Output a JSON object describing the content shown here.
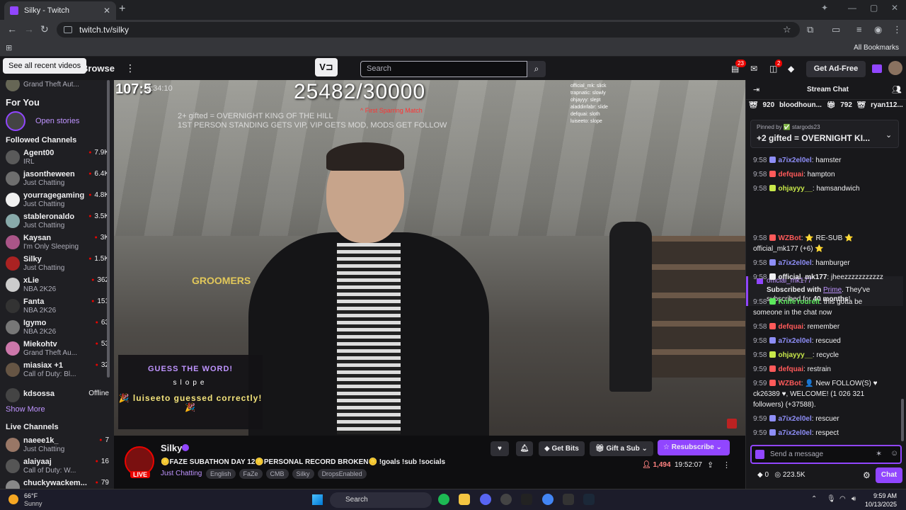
{
  "browser": {
    "tab_title": "Silky - Twitch",
    "url": "twitch.tv/silky",
    "all_bookmarks": "All Bookmarks"
  },
  "topnav": {
    "tooltip": "See all recent videos",
    "browse": "Browse",
    "search_placeholder": "Search",
    "notif_count": "23",
    "whisper_count": "2",
    "get_ad_free": "Get Ad-Free"
  },
  "sidebar": {
    "top_game": "Grand Theft Aut...",
    "for_you": "For You",
    "open_stories": "Open stories",
    "followed_header": "Followed Channels",
    "followed": [
      {
        "name": "Agent00",
        "game": "IRL",
        "viewers": "7.9K",
        "color": "#5a5a5a"
      },
      {
        "name": "jasontheween",
        "game": "Just Chatting",
        "viewers": "6.4K",
        "color": "#6e6e6e"
      },
      {
        "name": "yourragegaming",
        "game": "Just Chatting",
        "viewers": "4.8K",
        "color": "#f0f0f0"
      },
      {
        "name": "stableronaldo",
        "game": "Just Chatting",
        "viewers": "3.5K",
        "color": "#8aa"
      },
      {
        "name": "Kaysan",
        "game": "I'm Only Sleeping",
        "viewers": "3K",
        "color": "#a58"
      },
      {
        "name": "Silky",
        "game": "Just Chatting",
        "viewers": "1.5K",
        "color": "#a22"
      },
      {
        "name": "xLie",
        "game": "NBA 2K26",
        "viewers": "362",
        "color": "#ccc"
      },
      {
        "name": "Fanta",
        "game": "NBA 2K26",
        "viewers": "151",
        "color": "#333"
      },
      {
        "name": "Igymo",
        "game": "NBA 2K26",
        "viewers": "63",
        "color": "#777"
      },
      {
        "name": "Miekohtv",
        "game": "Grand Theft Au...",
        "viewers": "53",
        "color": "#c7a"
      },
      {
        "name": "miasiax +1",
        "game": "Call of Duty: Bl...",
        "viewers": "32",
        "color": "#654"
      }
    ],
    "offline": {
      "name": "kdsossa",
      "status": "Offline"
    },
    "show_more": "Show More",
    "live_header": "Live Channels",
    "live": [
      {
        "name": "naeee1k_",
        "game": "Just Chatting",
        "viewers": "7",
        "color": "#976"
      },
      {
        "name": "alaiyaaj",
        "game": "Call of Duty: W...",
        "viewers": "16",
        "color": "#555"
      },
      {
        "name": "chuckywackem...",
        "game": "",
        "viewers": "79",
        "color": "#888"
      }
    ]
  },
  "video": {
    "timer": "107:5",
    "timer_sub": "3:34:10",
    "sub_count": "25482/30000",
    "sparring": "^ First Sparring Match",
    "goal_line1": "2+ gifted = OVERNIGHT KING OF THE HILL",
    "goal_line2": "1ST PERSON STANDING GETS VIP, VIP GETS MOD, MODS GET FOLLOW",
    "store_sign": "GROOMERS",
    "chat_overlay": [
      "official_mk: slick",
      "trapnatic: slowly",
      "ohjayyy: slept",
      "aladdinfabr: slide",
      "defquai: sloth",
      "luiseeto: slope"
    ],
    "word_game": {
      "title": "GUESS THE WORD!",
      "word": "slope",
      "guess": "🎉 luiseeto guessed correctly! 🎉"
    }
  },
  "stream_info": {
    "name": "Silky",
    "live_label": "LIVE",
    "title": "🪙FAZE SUBATHON DAY 12🪙PERSONAL RECORD BROKEN🪙 !goals !sub !socials",
    "category": "Just Chatting",
    "tags": [
      "English",
      "FaZe",
      "CMB",
      "Silky",
      "DropsEnabled"
    ],
    "get_bits": "Get Bits",
    "gift_sub": "Gift a Sub",
    "resubscribe": "Resubscribe",
    "viewers": "1,494",
    "uptime": "19:52:07"
  },
  "chat": {
    "title": "Stream Chat",
    "gifters": [
      {
        "name": "bloodhoun...",
        "count": "920"
      },
      {
        "name": "",
        "count": "792"
      },
      {
        "name": "ryan112...",
        "count": ""
      }
    ],
    "pinned_by": "Pinned by ✅ stargods23",
    "pinned_text": "+2 gifted = OVERNIGHT KI...",
    "messages": [
      {
        "ts": "9:58",
        "user": "a7ix2el0el",
        "color": "#8e8ef7",
        "text": "hamster"
      },
      {
        "ts": "9:58",
        "user": "defquai",
        "color": "#ff5a5a",
        "text": "hampton"
      },
      {
        "ts": "9:58",
        "user": "ohjayyy__",
        "color": "#c8e84a",
        "text": "hamsandwich"
      }
    ],
    "sub_card": {
      "user": "official_mk177",
      "text_prefix": "Subscribed with ",
      "prime": "Prime",
      "text_mid": ". They've subscribed for ",
      "months": "40 months",
      "text_suffix": "!"
    },
    "messages2": [
      {
        "ts": "9:58",
        "user": "WZBot",
        "color": "#ff5a5a",
        "text": "⭐ RE-SUB ⭐ official_mk177 (+6) ⭐"
      },
      {
        "ts": "9:58",
        "user": "a7ix2el0el",
        "color": "#8e8ef7",
        "text": "hamburger"
      },
      {
        "ts": "9:58",
        "user": "official_mk177",
        "color": "#efeff1",
        "text": "jheezzzzzzzzzzz"
      },
      {
        "ts": "9:58",
        "user": "KnifeYourelt",
        "color": "#5ce85c",
        "text": "this gotta be someone in the chat now"
      },
      {
        "ts": "9:58",
        "user": "defquai",
        "color": "#ff5a5a",
        "text": "remember"
      },
      {
        "ts": "9:58",
        "user": "a7ix2el0el",
        "color": "#8e8ef7",
        "text": "rescued"
      },
      {
        "ts": "9:58",
        "user": "ohjayyy__",
        "color": "#c8e84a",
        "text": "recycle"
      },
      {
        "ts": "9:59",
        "user": "defquai",
        "color": "#ff5a5a",
        "text": "restrain"
      },
      {
        "ts": "9:59",
        "user": "WZBot",
        "color": "#ff5a5a",
        "text": "👤 New FOLLOW(S) ♥ ck26389 ♥, WELCOME! (1 026 321 followers) (+37588)."
      },
      {
        "ts": "9:59",
        "user": "a7ix2el0el",
        "color": "#8e8ef7",
        "text": "rescuer"
      },
      {
        "ts": "9:59",
        "user": "a7ix2el0el",
        "color": "#8e8ef7",
        "text": "respect"
      }
    ],
    "input_placeholder": "Send a message",
    "bits": "0",
    "points": "223.5K",
    "chat_button": "Chat"
  },
  "taskbar": {
    "temp": "66°F",
    "condition": "Sunny",
    "search": "Search",
    "time": "9:59 AM",
    "date": "10/13/2025"
  }
}
